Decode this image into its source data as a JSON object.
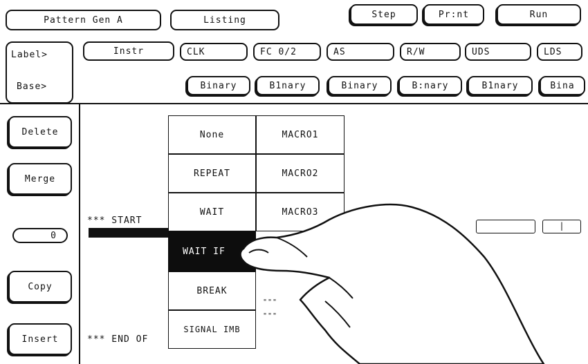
{
  "top_bar": {
    "pattern_gen": "Pattern Gen A",
    "listing": "Listing",
    "step": "Step",
    "print": "Pr:nt",
    "run": "Run"
  },
  "label_row": {
    "label_button": "Label>",
    "base_button": "Base>",
    "instr": "Instr",
    "labels": [
      "CLK",
      "FC 0/2",
      "AS",
      "R/W",
      "UDS",
      "LDS"
    ],
    "bases": [
      "Binary",
      "B1nary",
      "Binary",
      "B:nary",
      "B1nary",
      "Bina"
    ]
  },
  "side_buttons": {
    "delete": "Delete",
    "merge": "Merge",
    "counter": "0",
    "copy": "Copy",
    "insert": "Insert"
  },
  "listing": {
    "start_line": "*** START",
    "end_line": "*** END OF",
    "ticks_1": "\"\"\"",
    "ticks_2": "\"\"\"",
    "field_mark": "|"
  },
  "instruction_menu": {
    "left_column": [
      "None",
      "REPEAT",
      "WAIT",
      "WAIT IF",
      "BREAK",
      "SIGNAL IMB"
    ],
    "right_column": [
      "MACRO1",
      "MACRO2",
      "MACRO3"
    ],
    "selected": "WAIT IF"
  },
  "colors": {
    "foreground": "#111111",
    "background": "#ffffff",
    "highlight": "#0d0d0d"
  }
}
